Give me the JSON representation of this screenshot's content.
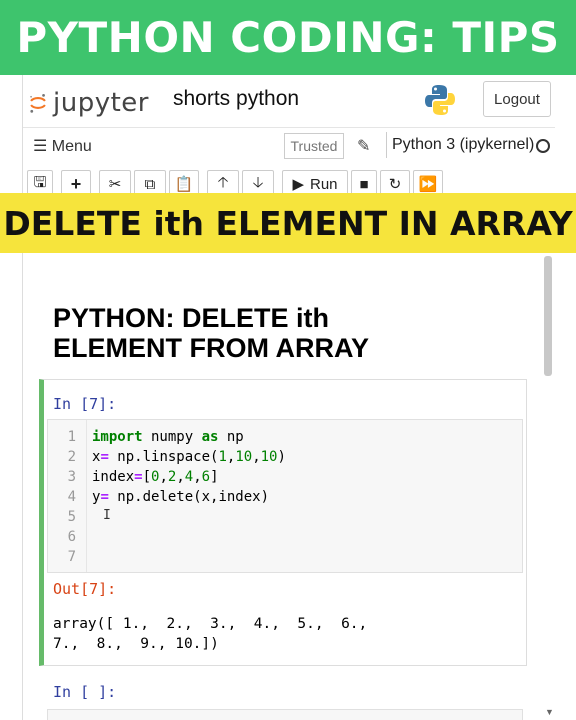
{
  "banner_top": "PYTHON CODING: TIPS",
  "banner_mid": "DELETE ith ELEMENT IN ARRAY",
  "header": {
    "logo_text": "jupyter",
    "notebook_name": "shorts python",
    "logout_label": "Logout"
  },
  "menubar": {
    "menu_label": "Menu",
    "trusted_label": "Trusted",
    "kernel_label": "Python 3 (ipykernel)"
  },
  "toolbar": {
    "run_label": "Run"
  },
  "notebook": {
    "heading_line1": "PYTHON: DELETE ith",
    "heading_line2": "ELEMENT FROM ARRAY",
    "cell1_in_prompt": "In [7]:",
    "cell1_out_prompt": "Out[7]:",
    "line_numbers": [
      "1",
      "2",
      "3",
      "4",
      "5",
      "6",
      "7"
    ],
    "code_lines": [
      "import numpy as np",
      "x= np.linspace(1,10,10)",
      "index=[0,2,4,6]",
      "y= np.delete(x,index)"
    ],
    "output_line1": "array([ 1.,  2.,  3.,  4.,  5.,  6.,",
    "output_line2": "7.,  8.,  9., 10.])",
    "cell2_in_prompt": "In [ ]:"
  },
  "colors": {
    "top_banner": "#3ec46d",
    "mid_banner": "#f6e43c",
    "selected_cell_border": "#66bb6a"
  }
}
